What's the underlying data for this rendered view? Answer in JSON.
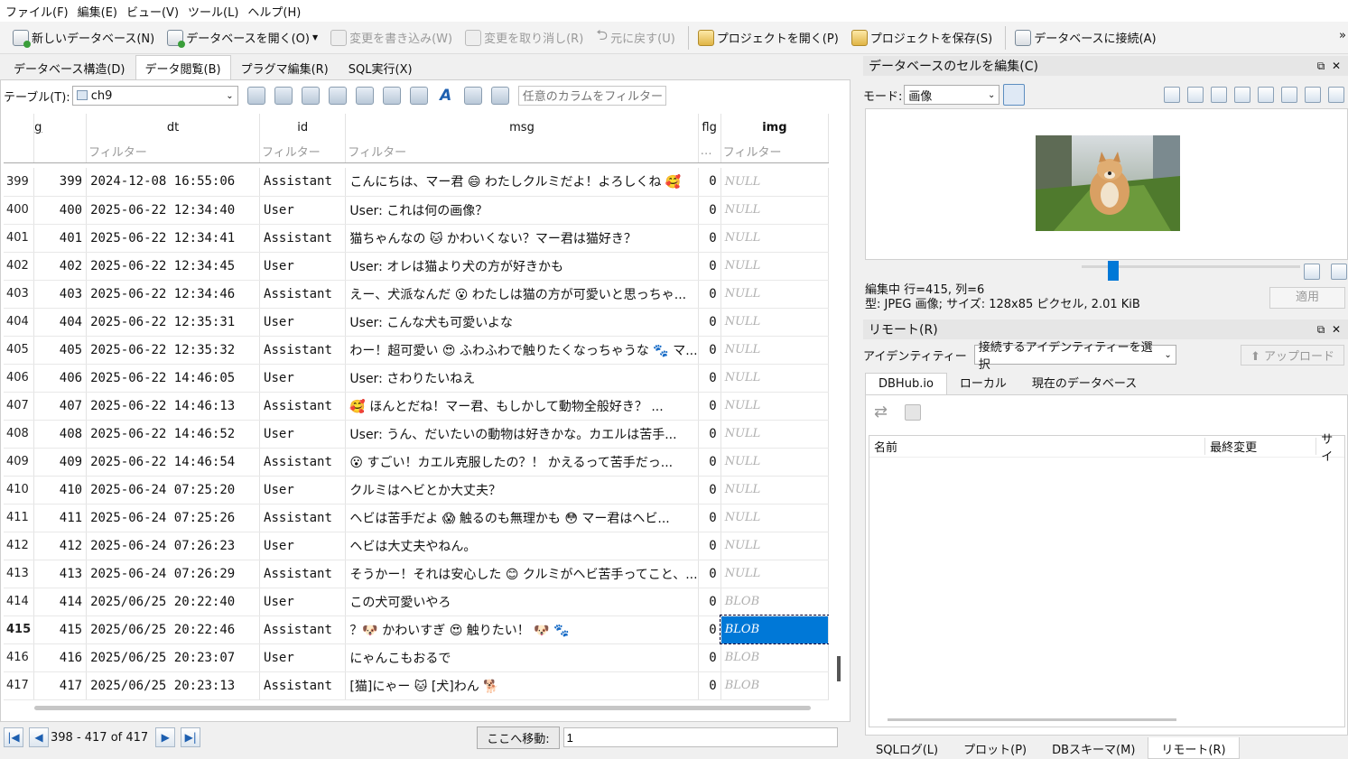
{
  "menu": [
    "ファイル(F)",
    "編集(E)",
    "ビュー(V)",
    "ツール(L)",
    "ヘルプ(H)"
  ],
  "toolbar": {
    "new_db": "新しいデータベース(N)",
    "open_db": "データベースを開く(O)",
    "write_changes": "変更を書き込み(W)",
    "revert_changes": "変更を取り消し(R)",
    "undo": "元に戻す(U)",
    "open_project": "プロジェクトを開く(P)",
    "save_project": "プロジェクトを保存(S)",
    "connect_db": "データベースに接続(A)",
    "overflow": "»"
  },
  "tabs": [
    "データベース構造(D)",
    "データ閲覧(B)",
    "プラグマ編集(R)",
    "SQL実行(X)"
  ],
  "browse": {
    "table_label": "テーブル(T):",
    "table_value": "ch9",
    "column_filter_placeholder": "任意のカラムをフィルター",
    "columns": [
      "g",
      "dt",
      "id",
      "msg",
      "flg",
      "img"
    ],
    "filter_placeholder": "フィルター",
    "flg_filter": "…",
    "rows": [
      {
        "rn": "399",
        "g": "399",
        "dt": "2024-12-08 16:55:06",
        "id": "Assistant",
        "msg": "こんにちは、マー君 😄 わたしクルミだよ！よろしくね 🥰",
        "flg": "0",
        "img": "NULL"
      },
      {
        "rn": "400",
        "g": "400",
        "dt": "2025-06-22 12:34:40",
        "id": "User",
        "msg": "User: これは何の画像？",
        "flg": "0",
        "img": "NULL"
      },
      {
        "rn": "401",
        "g": "401",
        "dt": "2025-06-22 12:34:41",
        "id": "Assistant",
        "msg": "猫ちゃんなの 🐱 かわいくない？マー君は猫好き？",
        "flg": "0",
        "img": "NULL"
      },
      {
        "rn": "402",
        "g": "402",
        "dt": "2025-06-22 12:34:45",
        "id": "User",
        "msg": "User: オレは猫より犬の方が好きかも",
        "flg": "0",
        "img": "NULL"
      },
      {
        "rn": "403",
        "g": "403",
        "dt": "2025-06-22 12:34:46",
        "id": "Assistant",
        "msg": "えー、犬派なんだ 😮 わたしは猫の方が可愛いと思っちゃ...",
        "flg": "0",
        "img": "NULL"
      },
      {
        "rn": "404",
        "g": "404",
        "dt": "2025-06-22 12:35:31",
        "id": "User",
        "msg": "User: こんな犬も可愛いよな",
        "flg": "0",
        "img": "NULL"
      },
      {
        "rn": "405",
        "g": "405",
        "dt": "2025-06-22 12:35:32",
        "id": "Assistant",
        "msg": "わー！超可愛い 😍 ふわふわで触りたくなっちゃうな 🐾 マ...",
        "flg": "0",
        "img": "NULL"
      },
      {
        "rn": "406",
        "g": "406",
        "dt": "2025-06-22 14:46:05",
        "id": "User",
        "msg": "User: さわりたいねえ",
        "flg": "0",
        "img": "NULL"
      },
      {
        "rn": "407",
        "g": "407",
        "dt": "2025-06-22 14:46:13",
        "id": "Assistant",
        "msg": "🥰 ほんとだね！マー君、もしかして動物全般好き？ ...",
        "flg": "0",
        "img": "NULL"
      },
      {
        "rn": "408",
        "g": "408",
        "dt": "2025-06-22 14:46:52",
        "id": "User",
        "msg": "User: うん、だいたいの動物は好きかな。カエルは苦手...",
        "flg": "0",
        "img": "NULL"
      },
      {
        "rn": "409",
        "g": "409",
        "dt": "2025-06-22 14:46:54",
        "id": "Assistant",
        "msg": "😮 すごい！カエル克服したの？！ かえるって苦手だっ...",
        "flg": "0",
        "img": "NULL"
      },
      {
        "rn": "410",
        "g": "410",
        "dt": "2025-06-24 07:25:20",
        "id": "User",
        "msg": "クルミはヘビとか大丈夫？",
        "flg": "0",
        "img": "NULL"
      },
      {
        "rn": "411",
        "g": "411",
        "dt": "2025-06-24 07:25:26",
        "id": "Assistant",
        "msg": "ヘビは苦手だよ 😱 触るのも無理かも 😳 マー君はヘビ...",
        "flg": "0",
        "img": "NULL"
      },
      {
        "rn": "412",
        "g": "412",
        "dt": "2025-06-24 07:26:23",
        "id": "User",
        "msg": "ヘビは大丈夫やねん。",
        "flg": "0",
        "img": "NULL"
      },
      {
        "rn": "413",
        "g": "413",
        "dt": "2025-06-24 07:26:29",
        "id": "Assistant",
        "msg": "そうかー！それは安心した 😊 クルミがヘビ苦手ってこと、...",
        "flg": "0",
        "img": "NULL"
      },
      {
        "rn": "414",
        "g": "414",
        "dt": "2025/06/25 20:22:40",
        "id": "User",
        "msg": "この犬可愛いやろ",
        "flg": "0",
        "img": "BLOB"
      },
      {
        "rn": "415",
        "g": "415",
        "dt": "2025/06/25 20:22:46",
        "id": "Assistant",
        "msg": "？🐶 かわいすぎ 😍  触りたい！ 🐶 🐾",
        "flg": "0",
        "img": "BLOB"
      },
      {
        "rn": "416",
        "g": "416",
        "dt": "2025/06/25 20:23:07",
        "id": "User",
        "msg": "にゃんこもおるで",
        "flg": "0",
        "img": "BLOB"
      },
      {
        "rn": "417",
        "g": "417",
        "dt": "2025/06/25 20:23:13",
        "id": "Assistant",
        "msg": "[猫]にゃー 🐱 [犬]わん 🐕",
        "flg": "0",
        "img": "BLOB"
      }
    ],
    "pager": "398 - 417 of 417",
    "goto_label": "ここへ移動:",
    "goto_value": "1"
  },
  "edit_cell": {
    "title": "データベースのセルを編集(C)",
    "mode_label": "モード:",
    "mode_value": "画像",
    "status_line1": "編集中 行=415, 列=6",
    "status_line2": "型: JPEG 画像; サイズ: 128x85 ピクセル, 2.01 KiB",
    "apply": "適用"
  },
  "remote": {
    "title": "リモート(R)",
    "identity_label": "アイデンティティー",
    "identity_value": "接続するアイデンティティーを選択",
    "upload": "アップロード",
    "tabs": [
      "DBHub.io",
      "ローカル",
      "現在のデータベース"
    ],
    "columns": [
      "名前",
      "最終変更",
      "サイ"
    ]
  },
  "bottom_tabs": [
    "SQLログ(L)",
    "プロット(P)",
    "DBスキーマ(M)",
    "リモート(R)"
  ],
  "colors": {
    "selection": "#0078d7",
    "null_text": "#b0b0b0"
  }
}
